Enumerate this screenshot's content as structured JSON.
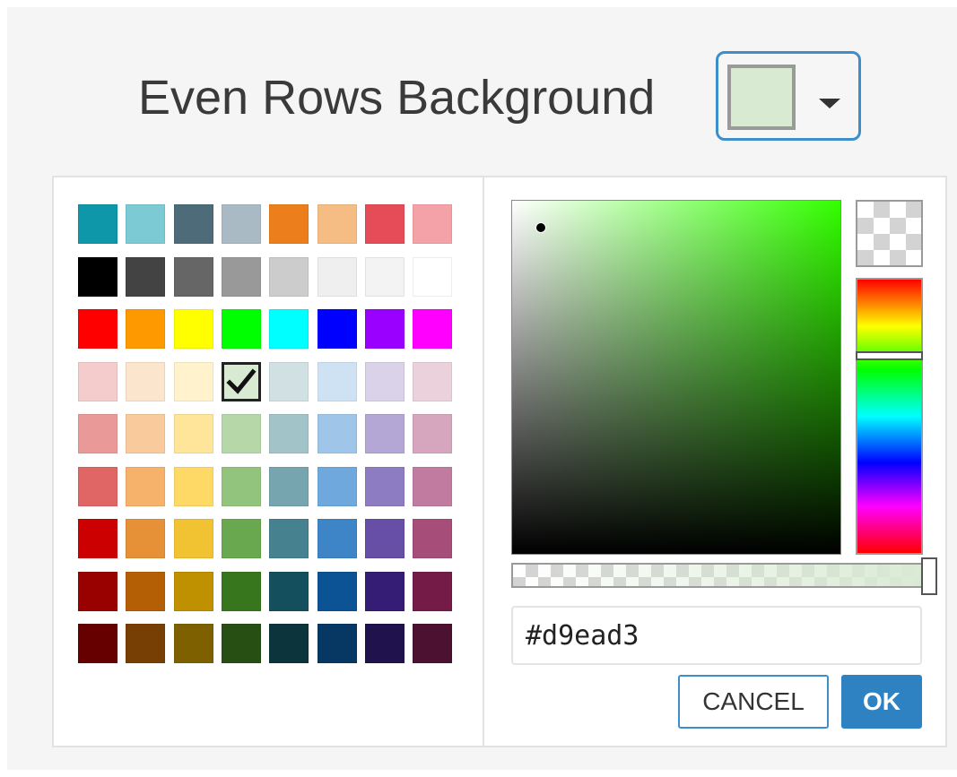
{
  "setting": {
    "label": "Even Rows Background",
    "current_color": "#d9ead3"
  },
  "palette": {
    "rows": [
      [
        "#0e97a8",
        "#7ccad3",
        "#4d6b79",
        "#a9bac4",
        "#ec7f1b",
        "#f5bd84",
        "#e54c57",
        "#f4a1a7"
      ],
      [
        "#000000",
        "#434343",
        "#666666",
        "#999999",
        "#cccccc",
        "#efefef",
        "#f3f3f3",
        "#ffffff"
      ],
      [
        "#ff0000",
        "#ff9900",
        "#ffff00",
        "#00ff00",
        "#00ffff",
        "#0000ff",
        "#9900ff",
        "#ff00ff"
      ],
      [
        "#f4cccc",
        "#fce5cd",
        "#fff2cc",
        "#d9ead3",
        "#d0e0e3",
        "#cfe2f3",
        "#d9d2e9",
        "#ead1dc"
      ],
      [
        "#ea9999",
        "#f9cb9c",
        "#ffe599",
        "#b6d7a8",
        "#a2c4c9",
        "#9fc5e8",
        "#b4a7d6",
        "#d5a6bd"
      ],
      [
        "#e06666",
        "#f6b26b",
        "#ffd966",
        "#93c47d",
        "#76a5af",
        "#6fa8dc",
        "#8e7cc3",
        "#c27ba0"
      ],
      [
        "#cc0000",
        "#e69138",
        "#f1c232",
        "#6aa84f",
        "#45818e",
        "#3d85c6",
        "#674ea7",
        "#a64d79"
      ],
      [
        "#990000",
        "#b45f06",
        "#bf9000",
        "#38761d",
        "#134f5c",
        "#0b5394",
        "#351c75",
        "#741b47"
      ],
      [
        "#660000",
        "#783f04",
        "#7f6000",
        "#274e13",
        "#0c343d",
        "#073763",
        "#20124d",
        "#4c1130"
      ]
    ],
    "selected_row": 3,
    "selected_col": 3
  },
  "picker": {
    "hue_color": "#33ff00",
    "hue_fraction": 0.28,
    "alpha": 1.0,
    "saturation": 0.1,
    "brightness": 0.92
  },
  "hex_input": {
    "value": "#d9ead3"
  },
  "buttons": {
    "cancel_label": "CANCEL",
    "ok_label": "OK"
  },
  "icons": {
    "check": "check-icon",
    "dropdown": "caret-down-icon"
  }
}
